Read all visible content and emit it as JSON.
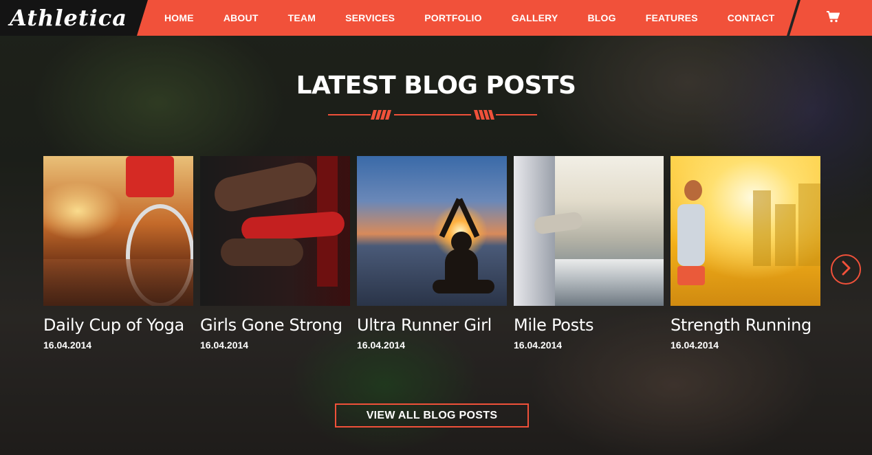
{
  "brand": {
    "logo_text": "Athletica"
  },
  "nav": {
    "items": [
      {
        "label": "HOME"
      },
      {
        "label": "ABOUT"
      },
      {
        "label": "TEAM"
      },
      {
        "label": "SERVICES"
      },
      {
        "label": "PORTFOLIO"
      },
      {
        "label": "GALLERY"
      },
      {
        "label": "BLOG"
      },
      {
        "label": "FEATURES"
      },
      {
        "label": "CONTACT"
      }
    ],
    "cart_icon": "cart-icon"
  },
  "section": {
    "title": "LATEST BLOG POSTS"
  },
  "posts": [
    {
      "title": "Daily Cup of Yoga",
      "date": "16.04.2014",
      "image": "mountain-biker-photo"
    },
    {
      "title": "Girls Gone Strong",
      "date": "16.04.2014",
      "image": "boxing-hand-wraps-photo"
    },
    {
      "title": "Ultra Runner Girl",
      "date": "16.04.2014",
      "image": "yoga-sunset-beach-photo"
    },
    {
      "title": "Mile Posts",
      "date": "16.04.2014",
      "image": "boat-shoes-sea-photo"
    },
    {
      "title": "Strength Running",
      "date": "16.04.2014",
      "image": "runner-city-sunlight-photo"
    }
  ],
  "carousel": {
    "next_icon": "chevron-right-icon"
  },
  "cta": {
    "label": "VIEW ALL BLOG POSTS"
  },
  "colors": {
    "accent": "#f1513a",
    "dark": "#141414"
  }
}
